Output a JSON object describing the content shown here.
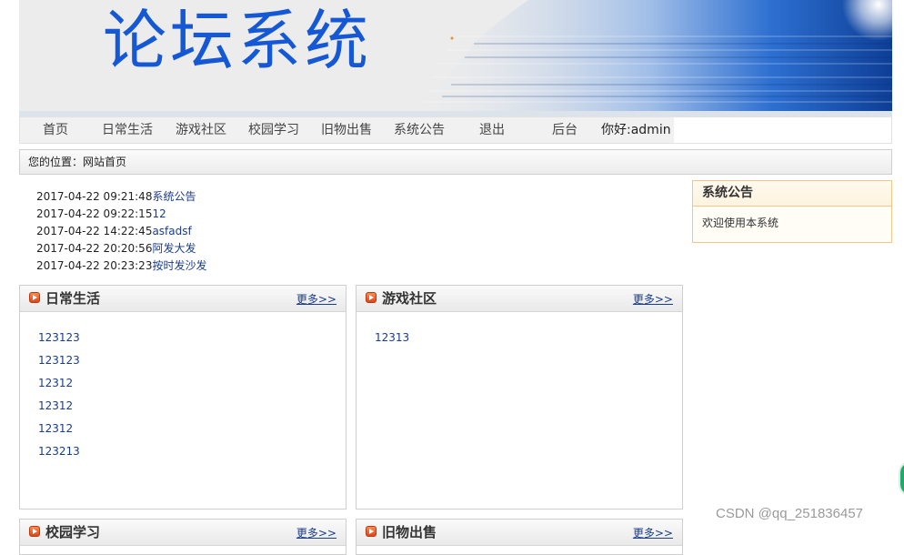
{
  "banner": {
    "title": "论坛系统"
  },
  "nav": {
    "items": [
      "首页",
      "日常生活",
      "游戏社区",
      "校园学习",
      "旧物出售",
      "系统公告",
      "退出",
      "后台"
    ],
    "greeting": "你好:admin"
  },
  "breadcrumb": {
    "text": "您的位置：网站首页"
  },
  "recent": [
    {
      "time": "2017-04-22 09:21:48",
      "title": "系统公告"
    },
    {
      "time": "2017-04-22 09:22:15",
      "title": "12"
    },
    {
      "time": "2017-04-22 14:22:45",
      "title": "asfadsf"
    },
    {
      "time": "2017-04-22 20:20:56",
      "title": "阿发大发"
    },
    {
      "time": "2017-04-22 20:23:23",
      "title": "按时发沙发"
    }
  ],
  "notice": {
    "title": "系统公告",
    "body": "欢迎使用本系统"
  },
  "panels": [
    {
      "title": "日常生活",
      "more": "更多>>",
      "items": [
        "123123",
        "123123",
        "12312",
        "12312",
        "12312",
        "123213"
      ]
    },
    {
      "title": "游戏社区",
      "more": "更多>>",
      "items": [
        "12313"
      ]
    },
    {
      "title": "校园学习",
      "more": "更多>>",
      "items": []
    },
    {
      "title": "旧物出售",
      "more": "更多>>",
      "items": []
    }
  ],
  "watermark": "CSDN @qq_251836457",
  "colors": {
    "brand_blue": "#1558d6",
    "link": "#1a3c8c",
    "notice_border": "#f0c98a"
  }
}
